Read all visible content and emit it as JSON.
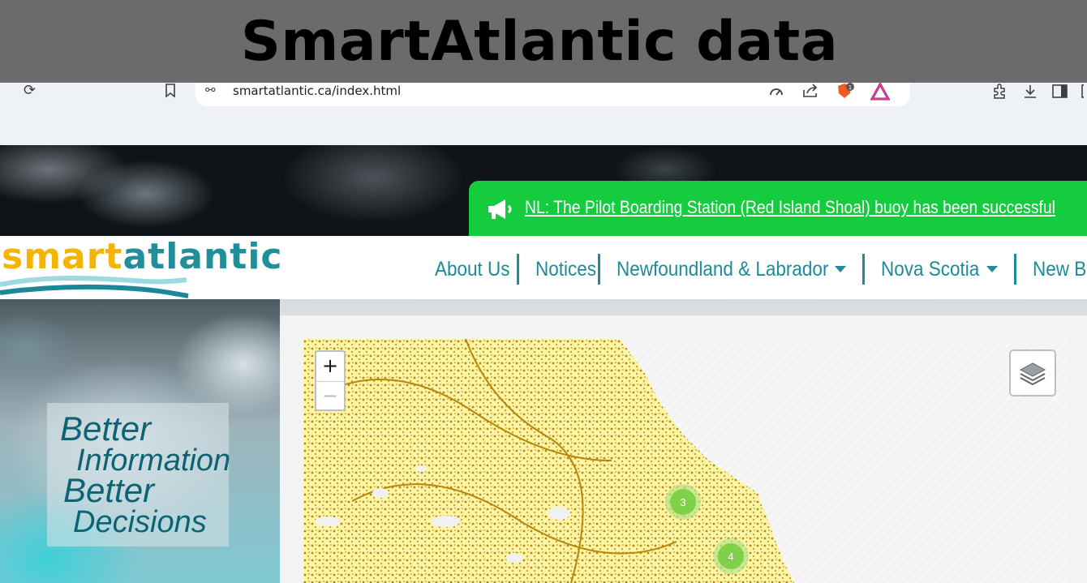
{
  "caption": {
    "title": "SmartAtlantic data"
  },
  "browser": {
    "url": "smartatlantic.ca/index.html",
    "icons": [
      "forward-icon",
      "reload-icon",
      "bookmark-icon",
      "site-settings-icon",
      "speed-icon",
      "share-icon",
      "brave-shields-icon",
      "brave-rewards-icon",
      "extensions-icon",
      "download-icon",
      "sidebar-icon"
    ],
    "shield_badge": "1"
  },
  "site": {
    "notice": "NL: The Pilot Boarding Station (Red Island Shoal) buoy has been successful",
    "logo": {
      "part1": "smart",
      "part2": "atlantic"
    },
    "nav": [
      {
        "label": "About Us",
        "dropdown": false
      },
      {
        "label": "Notices",
        "dropdown": false
      },
      {
        "label": "Newfoundland & Labrador",
        "dropdown": true
      },
      {
        "label": "Nova Scotia",
        "dropdown": true
      },
      {
        "label": "New Bru",
        "dropdown": false
      }
    ],
    "tagline": {
      "line1": "Better",
      "line2": "Information",
      "line3": "Better",
      "line4": "Decisions"
    },
    "map": {
      "zoom_in": "+",
      "zoom_out": "−",
      "clusters": [
        "3",
        "4"
      ]
    }
  },
  "colors": {
    "notice_bg": "#15cc3f",
    "brand_teal": "#1e8a9a",
    "brand_yellow": "#f4b400",
    "land": "#fdf5a6",
    "land_detail": "#b8860b"
  }
}
